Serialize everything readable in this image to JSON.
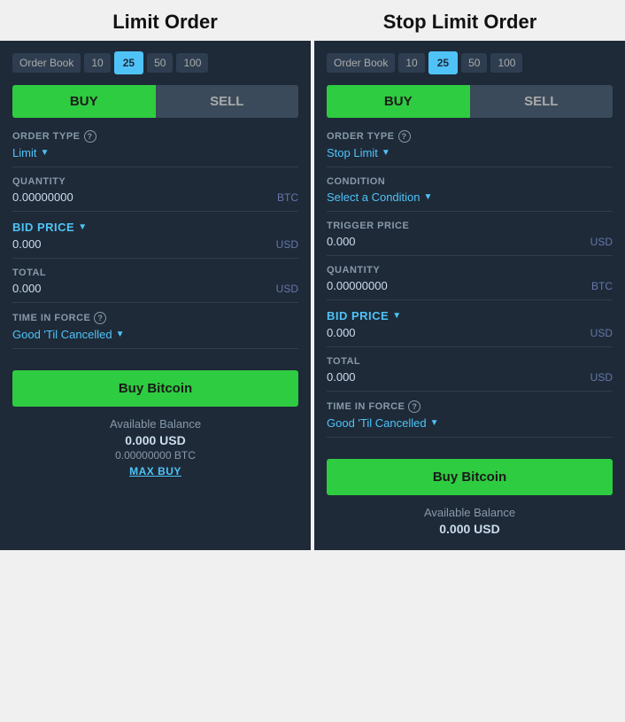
{
  "left": {
    "title": "Limit Order",
    "orderBook": {
      "label": "Order Book",
      "options": [
        "10",
        "25",
        "50",
        "100"
      ],
      "active": "25"
    },
    "buy_label": "BUY",
    "sell_label": "SELL",
    "orderType": {
      "label": "ORDER TYPE",
      "help": "?",
      "value": "Limit"
    },
    "quantity": {
      "label": "QUANTITY",
      "value": "0.00000000",
      "unit": "BTC"
    },
    "bidPrice": {
      "label": "BID PRICE",
      "value": "0.000",
      "unit": "USD"
    },
    "total": {
      "label": "TOTAL",
      "value": "0.000",
      "unit": "USD"
    },
    "timeInForce": {
      "label": "TIME IN FORCE",
      "help": "?",
      "value": "Good 'Til Cancelled"
    },
    "actionBtn": "Buy Bitcoin",
    "balance": {
      "title": "Available Balance",
      "usd": "0.000  USD",
      "btc": "0.00000000  BTC",
      "maxBuy": "MAX BUY"
    }
  },
  "right": {
    "title": "Stop Limit Order",
    "orderBook": {
      "label": "Order Book",
      "options": [
        "10",
        "25",
        "50",
        "100"
      ],
      "active": "25"
    },
    "buy_label": "BUY",
    "sell_label": "SELL",
    "orderType": {
      "label": "ORDER TYPE",
      "help": "?",
      "value": "Stop Limit"
    },
    "condition": {
      "label": "CONDITION",
      "value": "Select a Condition"
    },
    "triggerPrice": {
      "label": "TRIGGER PRICE",
      "value": "0.000",
      "unit": "USD"
    },
    "quantity": {
      "label": "QUANTITY",
      "value": "0.00000000",
      "unit": "BTC"
    },
    "bidPrice": {
      "label": "BID PRICE",
      "value": "0.000",
      "unit": "USD"
    },
    "total": {
      "label": "TOTAL",
      "value": "0.000",
      "unit": "USD"
    },
    "timeInForce": {
      "label": "TIME IN FORCE",
      "help": "?",
      "value": "Good 'Til Cancelled"
    },
    "actionBtn": "Buy Bitcoin",
    "balance": {
      "title": "Available Balance",
      "usd": "0.000  USD"
    }
  }
}
